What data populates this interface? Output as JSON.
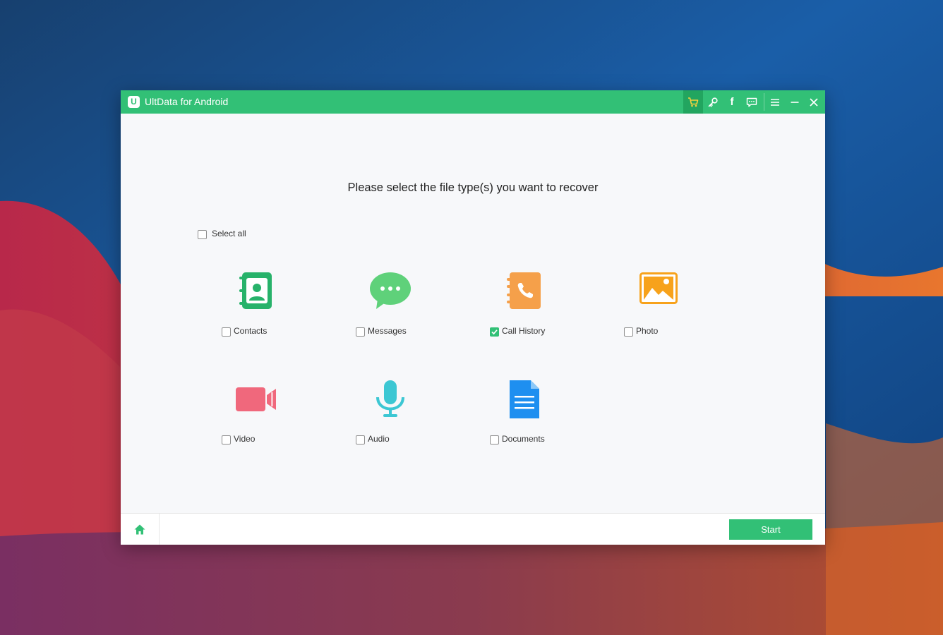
{
  "app": {
    "title": "UltData for Android",
    "logo_letter": "U"
  },
  "titlebar": {
    "icons": [
      "cart-icon",
      "key-icon",
      "facebook-icon",
      "feedback-icon",
      "menu-icon",
      "minimize-icon",
      "close-icon"
    ],
    "facebook_glyph": "f"
  },
  "main": {
    "heading": "Please select the file type(s) you want to recover",
    "select_all": {
      "label": "Select all",
      "checked": false
    },
    "file_types": [
      {
        "label": "Contacts",
        "icon": "contacts-icon",
        "checked": false
      },
      {
        "label": "Messages",
        "icon": "messages-icon",
        "checked": false
      },
      {
        "label": "Call History",
        "icon": "call-history-icon",
        "checked": true
      },
      {
        "label": "Photo",
        "icon": "photo-icon",
        "checked": false
      },
      {
        "label": "Video",
        "icon": "video-icon",
        "checked": false
      },
      {
        "label": "Audio",
        "icon": "audio-icon",
        "checked": false
      },
      {
        "label": "Documents",
        "icon": "documents-icon",
        "checked": false
      }
    ]
  },
  "footer": {
    "home_icon": "home-icon",
    "start_label": "Start"
  },
  "colors": {
    "accent": "#32c076",
    "accent_dark": "#22a55f",
    "contacts": "#27b26a",
    "messages": "#5fd17a",
    "call_history": "#f5a04a",
    "photo": "#f7a21b",
    "video": "#f0687c",
    "audio": "#3cc7d3",
    "documents": "#1e8ff0"
  }
}
